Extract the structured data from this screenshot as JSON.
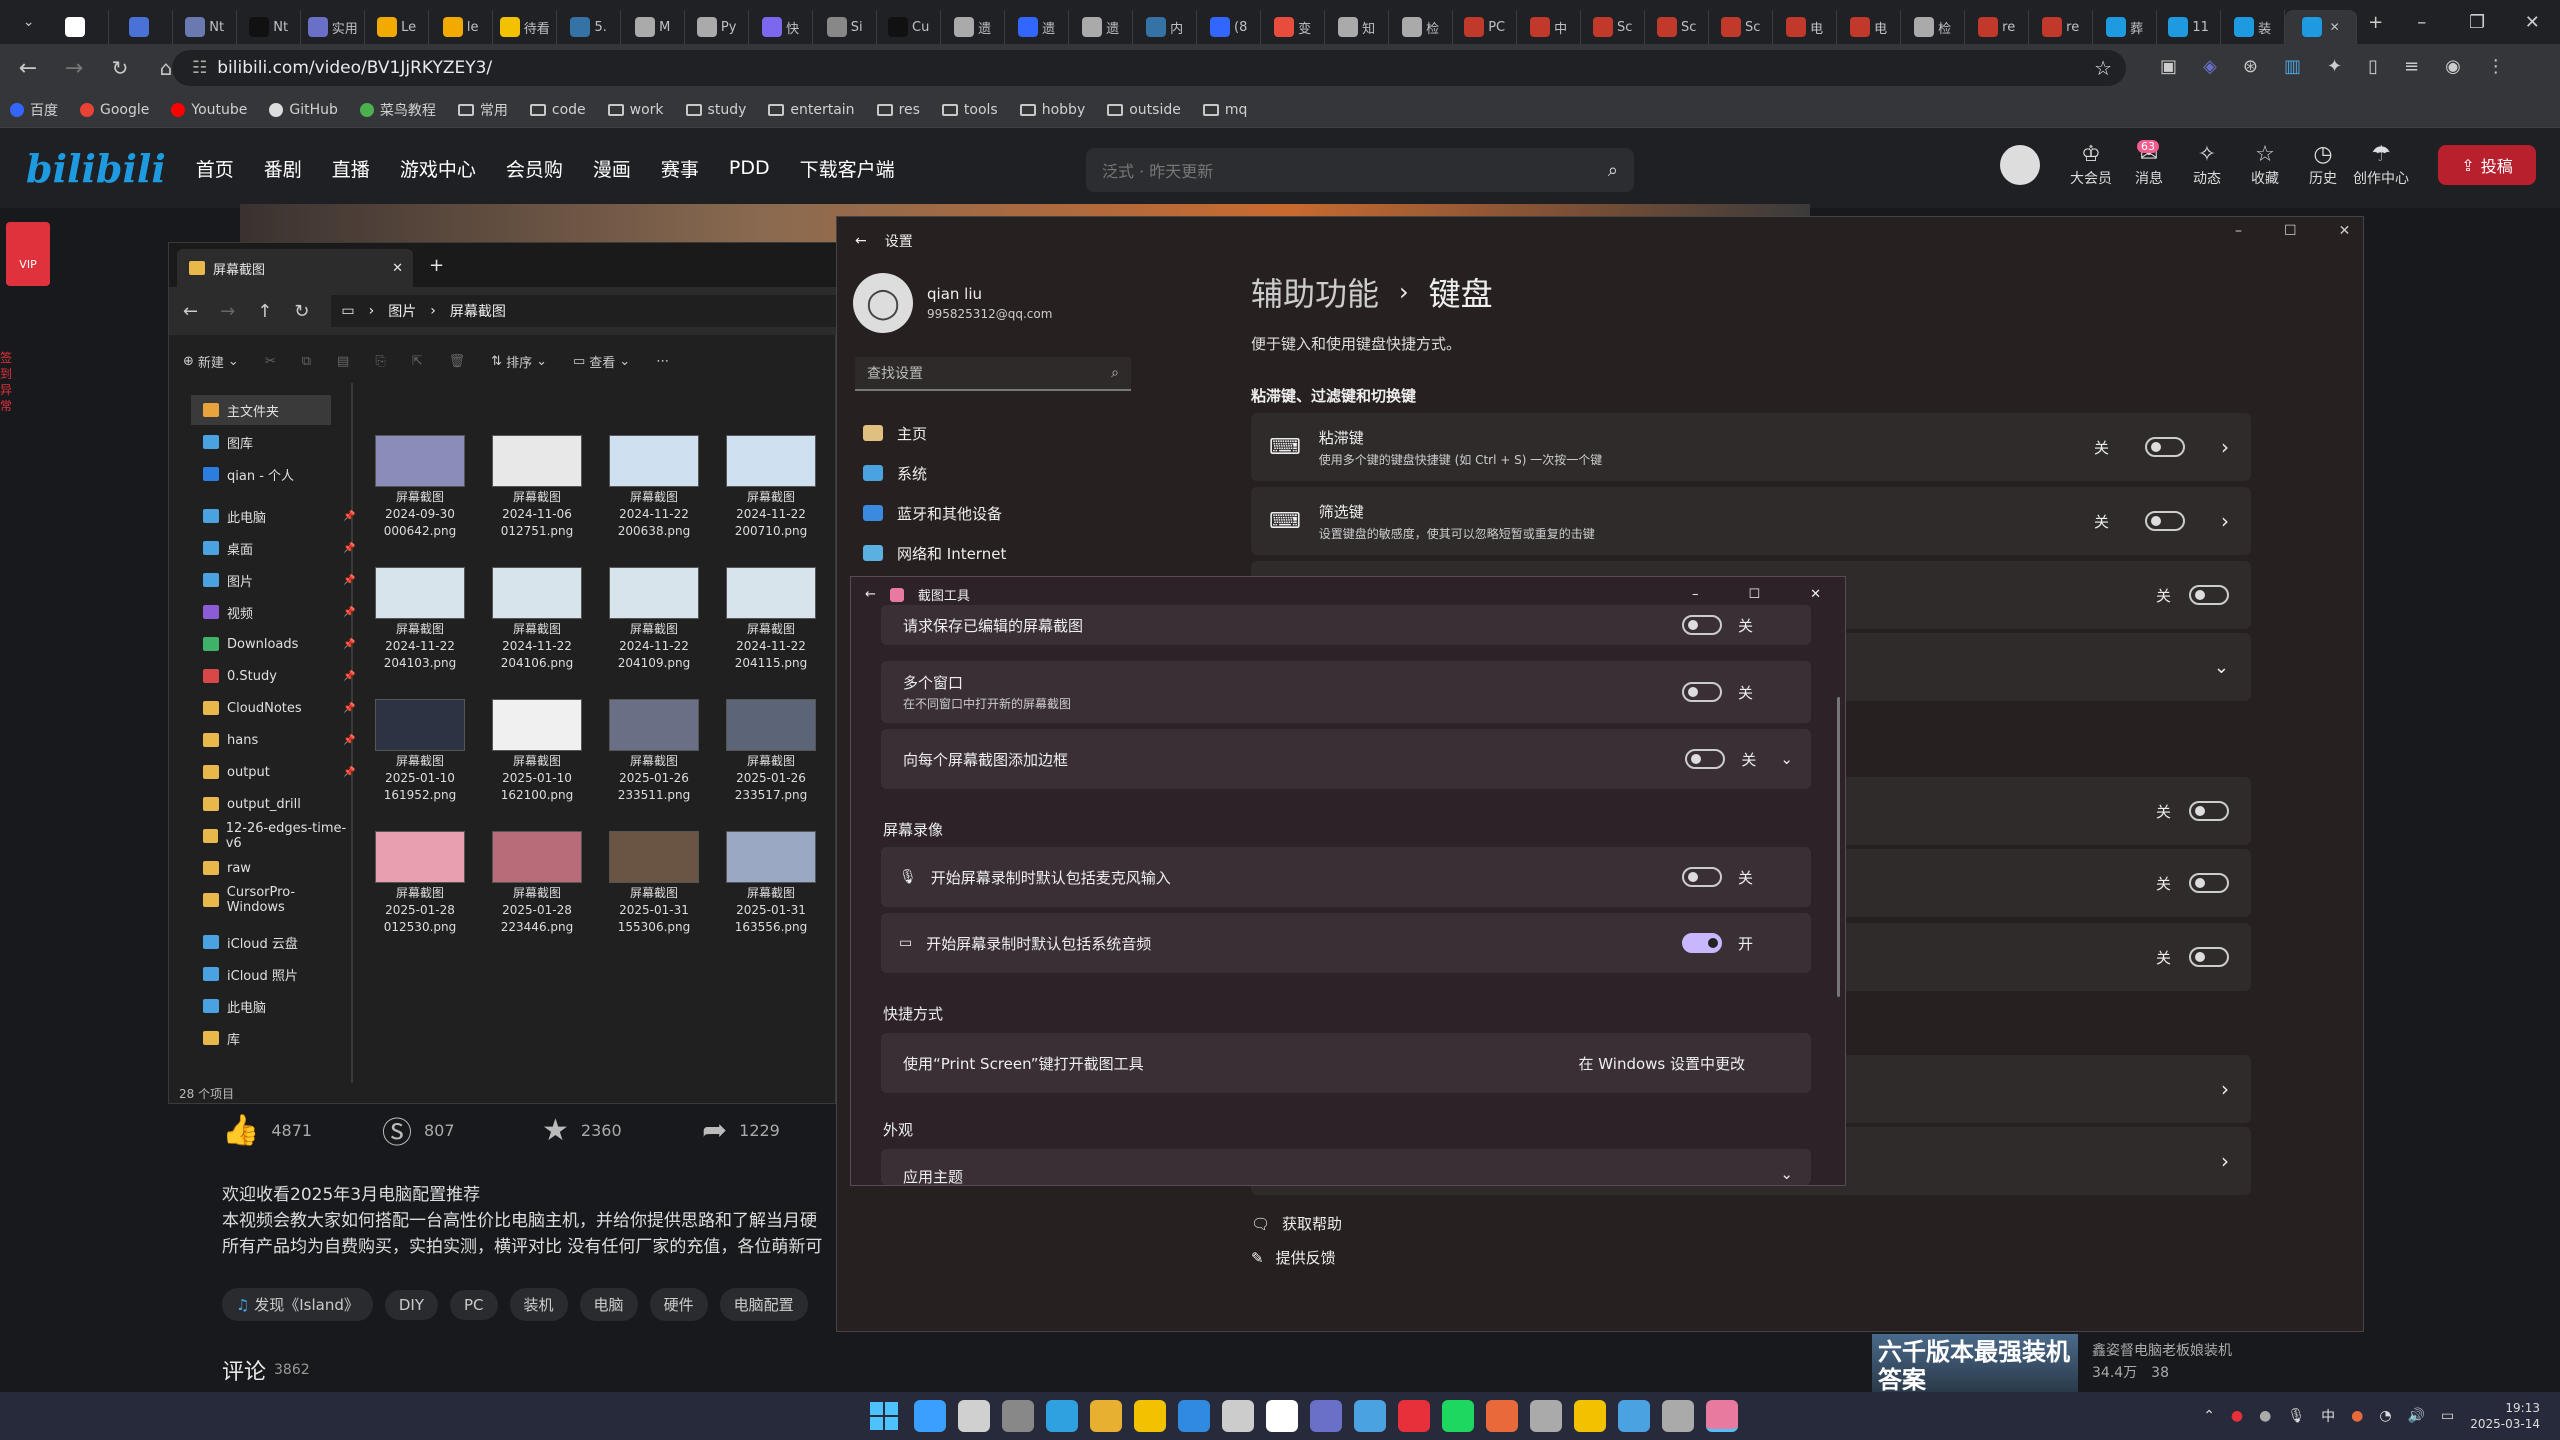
{
  "browser": {
    "tabs": [
      {
        "label": "",
        "color": "#ffffff"
      },
      {
        "label": "",
        "color": "#4a72d6"
      },
      {
        "label": "Nt",
        "color": "#6a7ab0"
      },
      {
        "label": "Nt",
        "color": "#111111"
      },
      {
        "label": "实用",
        "color": "#6a70c8"
      },
      {
        "label": "Le",
        "color": "#f2a900"
      },
      {
        "label": "le",
        "color": "#f2a900"
      },
      {
        "label": "待看",
        "color": "#f2c200"
      },
      {
        "label": "5.",
        "color": "#3572a5"
      },
      {
        "label": "M",
        "color": "#aaaaaa"
      },
      {
        "label": "Py",
        "color": "#aaaaaa"
      },
      {
        "label": "快",
        "color": "#7b68ee"
      },
      {
        "label": "Si",
        "color": "#888888"
      },
      {
        "label": "Cu",
        "color": "#111111"
      },
      {
        "label": "遗",
        "color": "#aaaaaa"
      },
      {
        "label": "遗",
        "color": "#3366ff"
      },
      {
        "label": "遗",
        "color": "#aaaaaa"
      },
      {
        "label": "内",
        "color": "#3572a5"
      },
      {
        "label": "(8",
        "color": "#3366ff"
      },
      {
        "label": "变",
        "color": "#e74c3c"
      },
      {
        "label": "知",
        "color": "#aaaaaa"
      },
      {
        "label": "检",
        "color": "#aaaaaa"
      },
      {
        "label": "PC",
        "color": "#c0392b"
      },
      {
        "label": "中",
        "color": "#c0392b"
      },
      {
        "label": "Sc",
        "color": "#c0392b"
      },
      {
        "label": "Sc",
        "color": "#c0392b"
      },
      {
        "label": "Sc",
        "color": "#c0392b"
      },
      {
        "label": "电",
        "color": "#c0392b"
      },
      {
        "label": "电",
        "color": "#c0392b"
      },
      {
        "label": "检",
        "color": "#aaaaaa"
      },
      {
        "label": "re",
        "color": "#c0392b"
      },
      {
        "label": "re",
        "color": "#c0392b"
      },
      {
        "label": "葬",
        "color": "#1e9be0"
      },
      {
        "label": "11",
        "color": "#1e9be0"
      },
      {
        "label": "装",
        "color": "#1e9be0"
      },
      {
        "label": "",
        "color": "#1e9be0"
      }
    ],
    "url": "bilibili.com/video/BV1JjRKYZEY3/",
    "bookmarks": [
      "百度",
      "Google",
      "Youtube",
      "GitHub",
      "菜鸟教程",
      "常用",
      "code",
      "work",
      "study",
      "entertain",
      "res",
      "tools",
      "hobby",
      "outside",
      "mq"
    ]
  },
  "bili": {
    "logo": "bilibili",
    "nav": [
      "首页",
      "番剧",
      "直播",
      "游戏中心",
      "会员购",
      "漫画",
      "赛事",
      "PDD",
      "下载客户端"
    ],
    "search_placeholder": "泛式 · 昨天更新",
    "right_icons": [
      "大会员",
      "消息",
      "动态",
      "收藏",
      "历史",
      "创作中心"
    ],
    "msg_badge": "63",
    "upload": "投稿",
    "vip": "VIP",
    "side_tag": "签到异常",
    "actions": [
      {
        "icon": "like-icon",
        "count": "4871"
      },
      {
        "icon": "coin-icon",
        "count": "807"
      },
      {
        "icon": "star-icon",
        "count": "2360"
      },
      {
        "icon": "share-icon",
        "count": "1229"
      }
    ],
    "desc_title": "欢迎收看2025年3月电脑配置推荐",
    "desc_line1": "本视频会教大家如何搭配一台高性价比电脑主机，并给你提供思路和了解当月硬",
    "desc_line2": "所有产品均为自费购买，实拍实测，横评对比 没有任何厂家的充值，各位萌新可",
    "tags": [
      "发现《Island》",
      "DIY",
      "PC",
      "装机",
      "电脑",
      "硬件",
      "电脑配置"
    ],
    "comments_label": "评论",
    "comments_count": "3862",
    "rec_title": "六千版本最强装机答案",
    "rec_author": "鑫姿督电脑老板娘装机",
    "rec_views": "34.4万",
    "rec_danmaku": "38"
  },
  "explorer": {
    "tab_title": "屏幕截图",
    "crumbs": [
      "图片",
      "屏幕截图"
    ],
    "toolbar": {
      "new": "新建",
      "sort": "排序",
      "view": "查看"
    },
    "nav": [
      {
        "label": "主文件夹",
        "color": "#e8a33c"
      },
      {
        "label": "图库",
        "color": "#4aa3e0"
      },
      {
        "label": "qian - 个人",
        "color": "#2b7de0"
      },
      {
        "label": "此电脑",
        "color": "#4aa3e0"
      },
      {
        "label": "桌面",
        "color": "#4aa3e0"
      },
      {
        "label": "图片",
        "color": "#4aa3e0"
      },
      {
        "label": "视频",
        "color": "#8c5bd6"
      },
      {
        "label": "Downloads",
        "color": "#3fb26a"
      },
      {
        "label": "0.Study",
        "color": "#d94848"
      },
      {
        "label": "CloudNotes",
        "color": "#e8b84a"
      },
      {
        "label": "hans",
        "color": "#e8b84a"
      },
      {
        "label": "output",
        "color": "#e8b84a"
      },
      {
        "label": "output_drill",
        "color": "#e8b84a"
      },
      {
        "label": "12-26-edges-time-v6",
        "color": "#e8b84a"
      },
      {
        "label": "raw",
        "color": "#e8b84a"
      },
      {
        "label": "CursorPro-Windows",
        "color": "#e8b84a"
      },
      {
        "label": "iCloud 云盘",
        "color": "#4aa3e0"
      },
      {
        "label": "iCloud 照片",
        "color": "#4aa3e0"
      },
      {
        "label": "此电脑",
        "color": "#4aa3e0"
      },
      {
        "label": "库",
        "color": "#e8b84a"
      }
    ],
    "files": [
      {
        "name": "屏幕截图",
        "date": "2024-09-30",
        "id": "000642.png",
        "color": "#8c8cb8"
      },
      {
        "name": "屏幕截图",
        "date": "2024-11-06",
        "id": "012751.png",
        "color": "#e8e8e8"
      },
      {
        "name": "屏幕截图",
        "date": "2024-11-22",
        "id": "200638.png",
        "color": "#cfe0f0"
      },
      {
        "name": "屏幕截图",
        "date": "2024-11-22",
        "id": "200710.png",
        "color": "#cfe0f0"
      },
      {
        "name": "屏幕截图",
        "date": "2024-11-22",
        "id": "204103.png",
        "color": "#d8e4ec"
      },
      {
        "name": "屏幕截图",
        "date": "2024-11-22",
        "id": "204106.png",
        "color": "#d8e4ec"
      },
      {
        "name": "屏幕截图",
        "date": "2024-11-22",
        "id": "204109.png",
        "color": "#d8e4ec"
      },
      {
        "name": "屏幕截图",
        "date": "2024-11-22",
        "id": "204115.png",
        "color": "#d8e4ec"
      },
      {
        "name": "屏幕截图",
        "date": "2025-01-10",
        "id": "161952.png",
        "color": "#2c3444"
      },
      {
        "name": "屏幕截图",
        "date": "2025-01-10",
        "id": "162100.png",
        "color": "#f0f0f0"
      },
      {
        "name": "屏幕截图",
        "date": "2025-01-26",
        "id": "233511.png",
        "color": "#6a6f86"
      },
      {
        "name": "屏幕截图",
        "date": "2025-01-26",
        "id": "233517.png",
        "color": "#5c6478"
      },
      {
        "name": "屏幕截图",
        "date": "2025-01-28",
        "id": "012530.png",
        "color": "#e8a0b0"
      },
      {
        "name": "屏幕截图",
        "date": "2025-01-28",
        "id": "223446.png",
        "color": "#b86c7a"
      },
      {
        "name": "屏幕截图",
        "date": "2025-01-31",
        "id": "155306.png",
        "color": "#6a5444"
      },
      {
        "name": "屏幕截图",
        "date": "2025-01-31",
        "id": "163556.png",
        "color": "#9aa8c4"
      }
    ],
    "status": "28 个项目"
  },
  "settings": {
    "title": "设置",
    "user_name": "qian liu",
    "user_email": "995825312@qq.com",
    "search_placeholder": "查找设置",
    "nav": [
      {
        "label": "主页",
        "icon": "home-icon"
      },
      {
        "label": "系统",
        "icon": "system-icon"
      },
      {
        "label": "蓝牙和其他设备",
        "icon": "bluetooth-icon"
      },
      {
        "label": "网络和 Internet",
        "icon": "network-icon"
      }
    ],
    "crumb1": "辅助功能",
    "crumb2": "键盘",
    "subtitle": "便于键入和使用键盘快捷方式。",
    "section": "粘滞键、过滤键和切换键",
    "cards": [
      {
        "title": "粘滞键",
        "desc": "使用多个键的键盘快捷键 (如 Ctrl + S) 一次按一个键",
        "state": "关"
      },
      {
        "title": "筛选键",
        "desc": "设置键盘的敏感度，使其可以忽略短暂或重复的击键",
        "state": "关"
      }
    ],
    "off": "关",
    "help": "获取帮助",
    "feedback": "提供反馈"
  },
  "snip": {
    "title": "截图工具",
    "rows": [
      {
        "title": "请求保存已编辑的屏幕截图",
        "desc": "",
        "state": "关"
      },
      {
        "title": "多个窗口",
        "desc": "在不同窗口中打开新的屏幕截图",
        "state": "关"
      },
      {
        "title": "向每个屏幕截图添加边框",
        "desc": "",
        "state": "关"
      }
    ],
    "rec_section": "屏幕录像",
    "rec_rows": [
      {
        "title": "开始屏幕录制时默认包括麦克风输入",
        "state": "关"
      },
      {
        "title": "开始屏幕录制时默认包括系统音频",
        "state": "开"
      }
    ],
    "shortcut_section": "快捷方式",
    "shortcut_title": "使用“Print Screen”键打开截图工具",
    "shortcut_link": "在 Windows 设置中更改",
    "appearance_section": "外观",
    "theme": "应用主题"
  },
  "taskbar": {
    "apps": [
      "#3aa0ff",
      "#d0d0d0",
      "#888888",
      "#2fa0e0",
      "#e8b030",
      "#f2c200",
      "#2f8ae0",
      "#cccccc",
      "#ffffff",
      "#6a70c8",
      "#4aa3e0",
      "#e8303a",
      "#1ed760",
      "#e86a3a",
      "#aaaaaa",
      "#f2c200",
      "#4aa3e0",
      "#aaaaaa",
      "#e87aa0"
    ],
    "ime": "中",
    "time": "19:13",
    "date": "2025-03-14"
  }
}
